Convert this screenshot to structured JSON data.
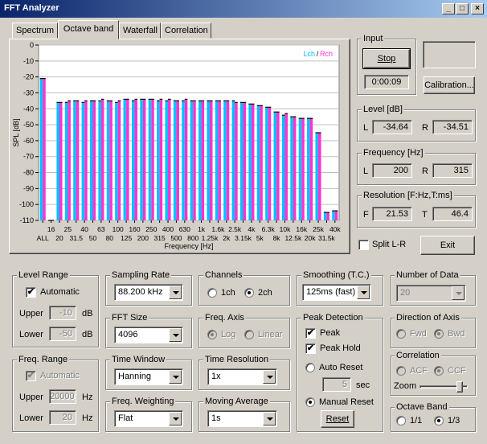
{
  "window": {
    "title": "FFT Analyzer",
    "minimize": "_",
    "maximize": "□",
    "close": "×"
  },
  "tabs": [
    "Spectrum",
    "Octave band",
    "Waterfall",
    "Correlation"
  ],
  "active_tab": "Octave band",
  "chart_data": {
    "type": "bar",
    "ylabel": "SPL [dB]",
    "xlabel": "Frequency [Hz]",
    "ylim": [
      -110,
      0
    ],
    "yticks": [
      "0",
      "-10",
      "-20",
      "-30",
      "-40",
      "-50",
      "-60",
      "-70",
      "-80",
      "-90",
      "-100",
      "-110"
    ],
    "xtick_top": [
      "16",
      "25",
      "40",
      "63",
      "100",
      "160",
      "250",
      "400",
      "630",
      "1k",
      "1.6k",
      "2.5k",
      "4k",
      "6.3k",
      "10k",
      "16k",
      "25k",
      "40k"
    ],
    "xtick_bottom": [
      "ALL",
      "20",
      "31.5",
      "50",
      "80",
      "125",
      "200",
      "315",
      "500",
      "800",
      "1.25k",
      "2k",
      "3.15k",
      "5k",
      "8k",
      "12.5k",
      "20k",
      "31.5k"
    ],
    "legend": {
      "l": "Lch",
      "sep": " / ",
      "r": "Rch"
    },
    "colors": {
      "l": "#00c0ff",
      "r": "#ff33cc"
    },
    "categories": [
      "ALL",
      "16",
      "20",
      "25",
      "31.5",
      "40",
      "50",
      "63",
      "80",
      "100",
      "125",
      "160",
      "200",
      "250",
      "315",
      "400",
      "500",
      "630",
      "800",
      "1k",
      "1.25k",
      "1.6k",
      "2k",
      "2.5k",
      "3.15k",
      "4k",
      "5k",
      "6.3k",
      "8k",
      "10k",
      "12.5k",
      "16k",
      "20k",
      "25k",
      "31.5k",
      "40k"
    ],
    "series": [
      {
        "name": "Lch",
        "values": [
          -21,
          -110,
          -36,
          -36,
          -35,
          -36,
          -35,
          -35,
          -35,
          -36,
          -34,
          -35,
          -34,
          -34,
          -35,
          -35,
          -35,
          -35,
          -35,
          -35,
          -35,
          -35,
          -35,
          -35,
          -36,
          -37,
          -38,
          -39,
          -42,
          -44,
          -45,
          -46,
          -46,
          -55,
          -105,
          -104
        ]
      },
      {
        "name": "Rch",
        "values": [
          -21,
          -110,
          -36,
          -35,
          -35,
          -35,
          -35,
          -34,
          -35,
          -35,
          -34,
          -34,
          -34,
          -34,
          -34,
          -34,
          -35,
          -34,
          -35,
          -35,
          -35,
          -35,
          -35,
          -36,
          -36,
          -37,
          -38,
          -39,
          -42,
          -43,
          -45,
          -46,
          -46,
          -55,
          -105,
          -104
        ]
      }
    ]
  },
  "input": {
    "label": "Input",
    "stop": "Stop",
    "time": "0:00:09",
    "calibration": "Calibration..."
  },
  "level": {
    "label": "Level [dB]",
    "l_label": "L",
    "l": "-34.64",
    "r_label": "R",
    "r": "-34.51"
  },
  "frequency": {
    "label": "Frequency [Hz]",
    "l_label": "L",
    "l": "200",
    "r_label": "R",
    "r": "315"
  },
  "resolution": {
    "label": "Resolution [F:Hz,T:ms]",
    "f_label": "F",
    "f": "21.53",
    "t_label": "T",
    "t": "46.4"
  },
  "split": {
    "label": "Split L-R",
    "checked": ""
  },
  "exit": "Exit",
  "level_range": {
    "label": "Level Range",
    "automatic": "Automatic",
    "check": "✔",
    "upper": "Upper",
    "upper_val": "-10",
    "lower": "Lower",
    "lower_val": "-50",
    "unit": "dB"
  },
  "freq_range": {
    "label": "Freq. Range",
    "automatic": "Automatic",
    "check": "✔",
    "upper": "Upper",
    "upper_val": "20000",
    "lower": "Lower",
    "lower_val": "20",
    "unit": "Hz"
  },
  "sampling": {
    "label": "Sampling Rate",
    "value": "88.200 kHz"
  },
  "fft_size": {
    "label": "FFT Size",
    "value": "4096"
  },
  "time_window": {
    "label": "Time Window",
    "value": "Hanning"
  },
  "freq_weighting": {
    "label": "Freq. Weighting",
    "value": "Flat"
  },
  "channels": {
    "label": "Channels",
    "opt1": "1ch",
    "opt2": "2ch",
    "selected": "2ch"
  },
  "freq_axis": {
    "label": "Freq. Axis",
    "opt1": "Log",
    "opt2": "Linear",
    "selected": "Log"
  },
  "time_resolution": {
    "label": "Time Resolution",
    "value": "1x"
  },
  "moving_average": {
    "label": "Moving Average",
    "value": "1s"
  },
  "smoothing": {
    "label": "Smoothing (T.C.)",
    "value": "125ms (fast)"
  },
  "peak_detection": {
    "label": "Peak Detection",
    "peak": "Peak",
    "peak_check": "✔",
    "peak_hold": "Peak Hold",
    "peak_hold_check": "✔",
    "auto_reset": "Auto Reset",
    "sec_val": "5",
    "sec": "sec",
    "manual_reset": "Manual Reset",
    "reset": "Reset",
    "selected": "Manual Reset"
  },
  "number_of_data": {
    "label": "Number of Data",
    "value": "20"
  },
  "direction": {
    "label": "Direction of Axis",
    "opt1": "Fwd",
    "opt2": "Bwd",
    "selected": "Bwd"
  },
  "correlation": {
    "label": "Correlation",
    "opt1": "ACF",
    "opt2": "CCF",
    "selected": "CCF",
    "zoom": "Zoom"
  },
  "octave_band": {
    "label": "Octave Band",
    "opt1": "1/1",
    "opt2": "1/3",
    "selected": "1/3"
  }
}
